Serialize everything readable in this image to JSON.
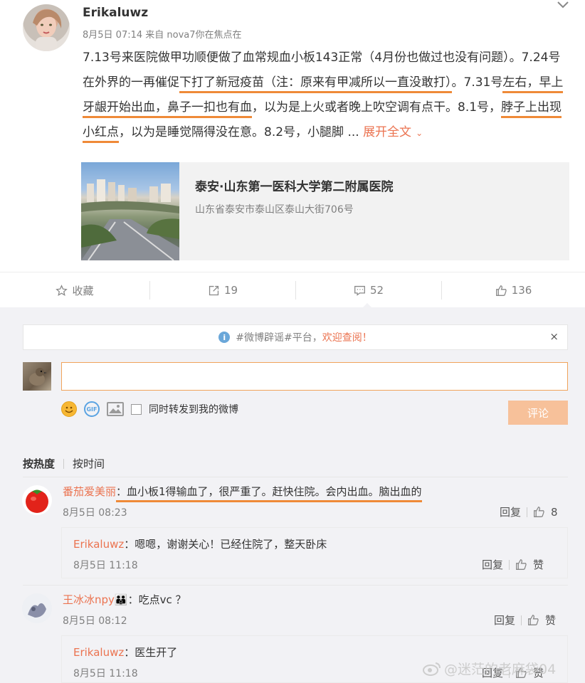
{
  "post": {
    "username": "Erikaluwz",
    "meta": "8月5日 07:14 来自 nova7你在焦点在",
    "text_1": "7.13号来医院做甲功顺便做了血常规血小板143正常（4月份也做过也没有问题）。7.24号在外界的一再催促",
    "text_2": "下打了新冠疫苗（注：原来有甲减所以一直没敢打）",
    "text_3": "。7.31号",
    "text_4": "左右，早上牙龈开始出血，鼻子一扣也有血",
    "text_5": "，以为是上火或者晚上吹空调有点干。8.1号，",
    "text_6": "脖子上出现小红点",
    "text_7": "，以为是睡觉隔得没在意。8.2号，小腿脚 ... ",
    "expand_label": "展开全文",
    "location": {
      "title": "泰安·山东第一医科大学第二附属医院",
      "address": "山东省泰安市泰山区泰山大街706号"
    }
  },
  "actions": {
    "favorite_label": "收藏",
    "repost_count": "19",
    "comment_count": "52",
    "like_count": "136"
  },
  "notice": {
    "prefix": "#微博辟谣#平台，",
    "highlight": "欢迎查阅！",
    "close": "×"
  },
  "composer": {
    "input_value": "",
    "sync_label": "同时转发到我的微博",
    "submit_label": "评论",
    "gif_label": "GIF"
  },
  "sort": {
    "hot": "按热度",
    "time": "按时间"
  },
  "comments": [
    {
      "name": "番茄爱美丽",
      "text": "：血小板1得输血了，很严重了。赶快住院。会内出血。脑出血的",
      "time": "8月5日 08:23",
      "reply_label": "回复",
      "likes": "8",
      "reply": {
        "name": "Erikaluwz",
        "text": "：嗯嗯，谢谢关心！已经住院了，整天卧床",
        "time": "8月5日 11:18",
        "reply_label": "回复",
        "like_label": "赞"
      }
    },
    {
      "name": "王冰冰npy",
      "badge": "👪",
      "text": "：吃点vc ？",
      "time": "8月5日 08:12",
      "reply_label": "回复",
      "like_label": "赞",
      "reply": {
        "name": "Erikaluwz",
        "text": "：医生开了",
        "time": "8月5日 11:18",
        "reply_label": "回复",
        "like_label": "赞"
      }
    }
  ],
  "watermark": "@迷茫的老麻袋04",
  "colors": {
    "accent": "#eb7350",
    "underline": "#ef8a38",
    "input_border": "#f0a35a",
    "submit_bg": "#f7c19a"
  }
}
